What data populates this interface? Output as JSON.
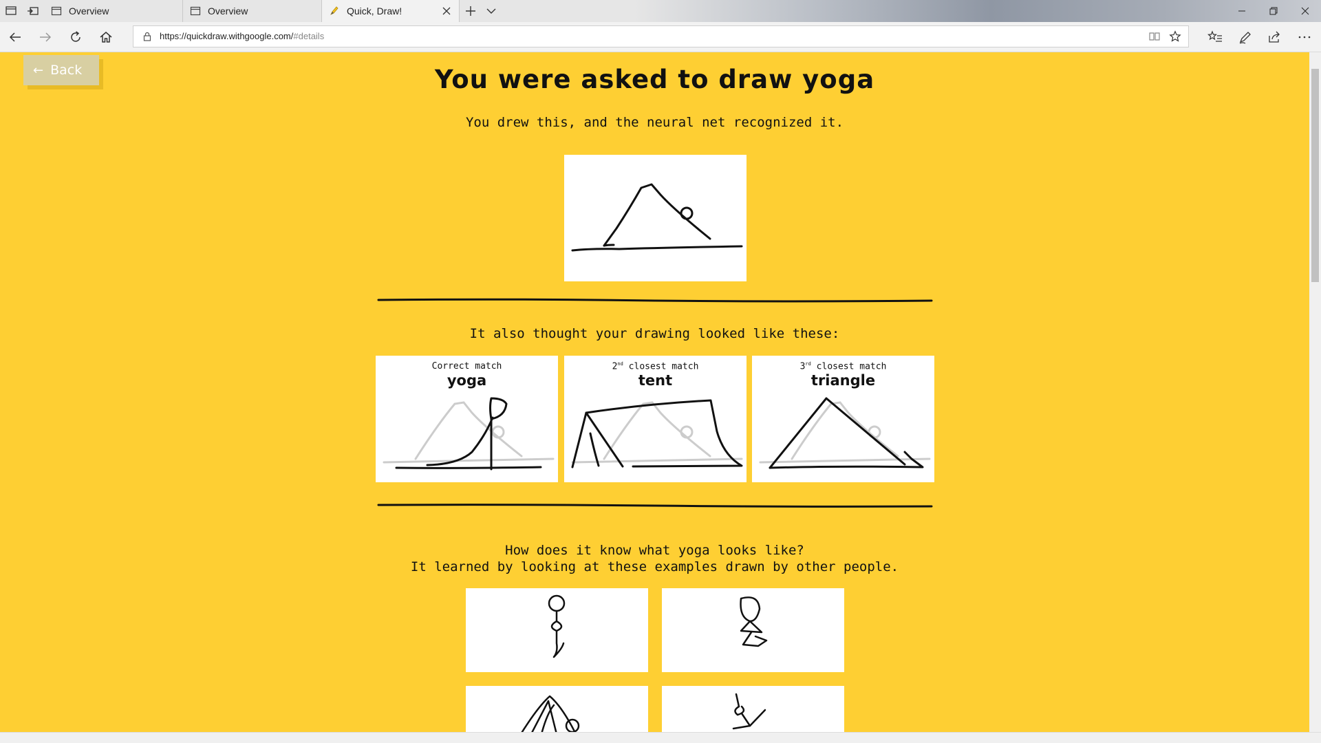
{
  "browser": {
    "tabs": [
      {
        "title": "Overview"
      },
      {
        "title": "Overview"
      },
      {
        "title": "Quick, Draw!"
      }
    ],
    "url": {
      "host": "https://quickdraw.withgoogle.com/",
      "path": "#details"
    },
    "icons": [
      "tab-preview-icon",
      "set-aside-icon",
      "page-icon",
      "pencil-favicon-icon",
      "close-icon",
      "plus-icon",
      "chevron-down-icon",
      "minimize-icon",
      "restore-icon",
      "close-window-icon",
      "back-arrow-icon",
      "forward-arrow-icon",
      "refresh-icon",
      "home-icon",
      "lock-icon",
      "reading-view-icon",
      "star-icon",
      "favorites-icon",
      "pen-icon",
      "share-icon",
      "more-icon"
    ]
  },
  "page": {
    "back_label": "Back",
    "heading": "You were asked to draw yoga",
    "subheading": "You drew this, and the neural net recognized it.",
    "also_text": "It also thought your drawing looked like these:",
    "matches": [
      {
        "caption": "Correct match",
        "ordinal": "",
        "name": "yoga"
      },
      {
        "caption": " closest match",
        "ordinal_num": "2",
        "ordinal_sup": "nd",
        "name": "tent"
      },
      {
        "caption": " closest match",
        "ordinal_num": "3",
        "ordinal_sup": "rd",
        "name": "triangle"
      }
    ],
    "how_line1": "How does it know what yoga looks like?",
    "how_line2": "It learned by looking at these examples drawn by other people."
  },
  "colors": {
    "background": "#fecf33",
    "back_button": "#d8cfa2",
    "card": "#ffffff",
    "ink": "#111111",
    "ghost_ink": "#cccccc"
  }
}
